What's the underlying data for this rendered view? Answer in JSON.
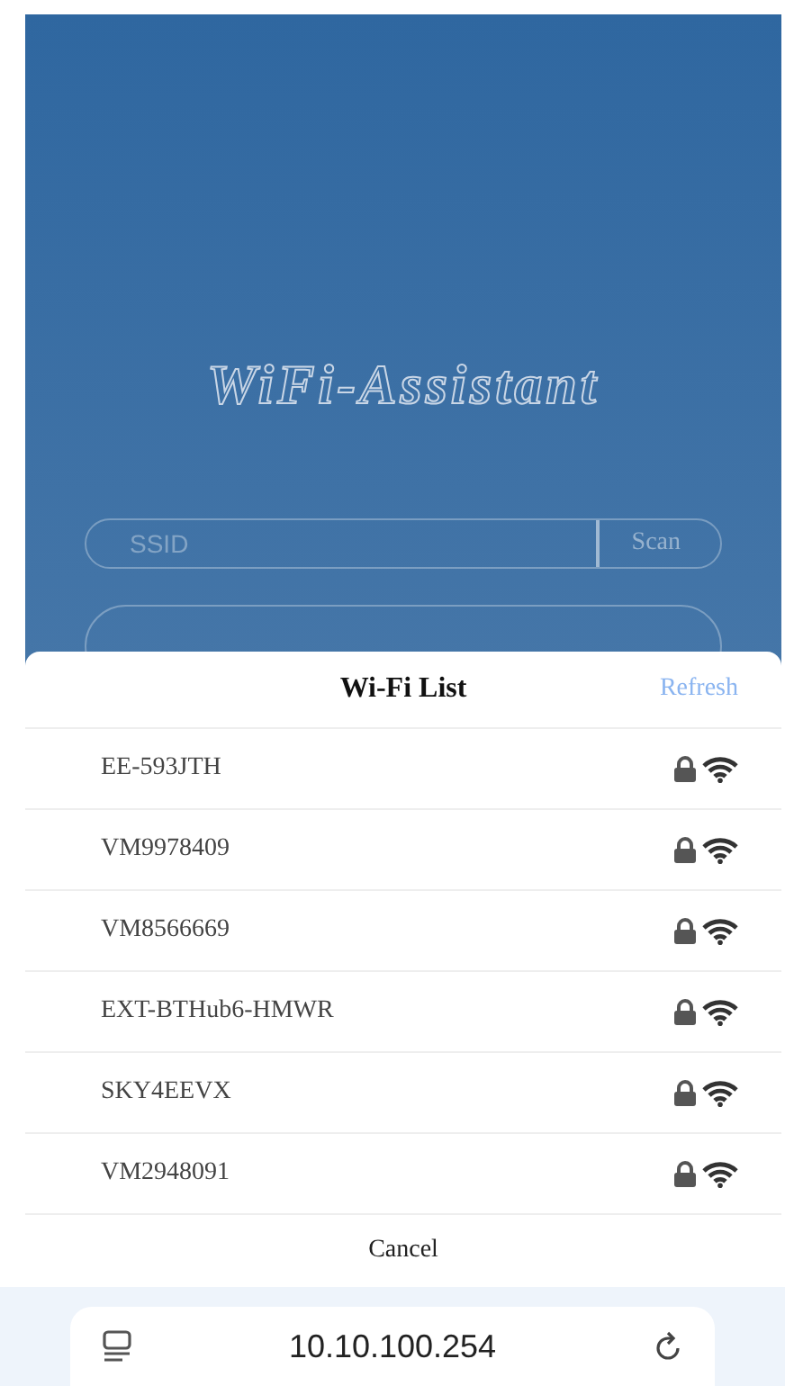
{
  "app": {
    "title": "WiFi-Assistant",
    "ssid_field": {
      "placeholder": "SSID"
    },
    "scan_button": "Scan"
  },
  "wifi_sheet": {
    "title": "Wi-Fi List",
    "refresh": "Refresh",
    "networks": [
      {
        "name": "EE-593JTH",
        "locked": true
      },
      {
        "name": "VM9978409",
        "locked": true
      },
      {
        "name": "VM8566669",
        "locked": true
      },
      {
        "name": "EXT-BTHub6-HMWR",
        "locked": true
      },
      {
        "name": "SKY4EEVX",
        "locked": true
      },
      {
        "name": "VM2948091",
        "locked": true
      }
    ],
    "cancel": "Cancel"
  },
  "browser_bar": {
    "address": "10.10.100.254"
  }
}
